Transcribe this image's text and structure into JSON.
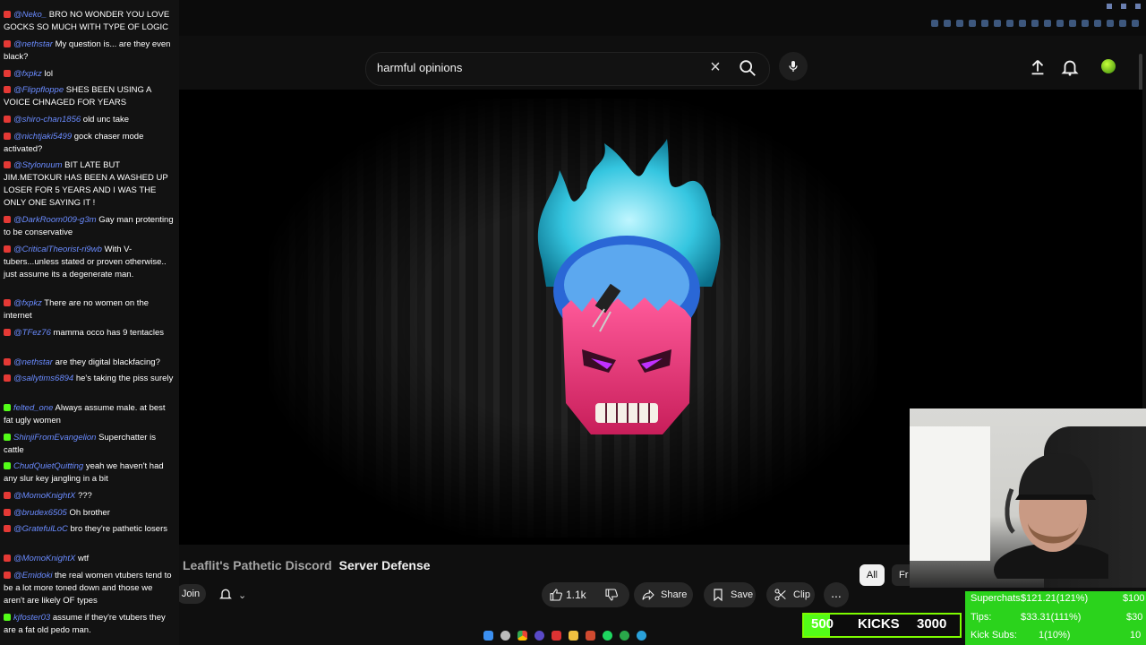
{
  "search": {
    "query": "harmful opinions"
  },
  "video": {
    "title_overlay": "Leaflit's Pathetic Discord",
    "title": "Server Defense",
    "join_label": "Join",
    "like_count": "1.1k",
    "share_label": "Share",
    "save_label": "Save",
    "clip_label": "Clip",
    "more_label": "...",
    "chips": [
      "All",
      "Fr"
    ]
  },
  "chat": [
    {
      "src": "yt",
      "user": "@Neko_",
      "text": "BRO NO WONDER YOU LOVE GOCKS SO MUCH WITH TYPE OF LOGIC"
    },
    {
      "src": "yt",
      "user": "@nethstar",
      "text": "My question is... are they even black?"
    },
    {
      "src": "yt",
      "user": "@fxpkz",
      "text": "lol"
    },
    {
      "src": "yt",
      "user": "@Flippfloppe",
      "text": "SHES BEEN USING A VOICE CHNAGED FOR YEARS"
    },
    {
      "src": "yt",
      "user": "@shiro-chan1856",
      "text": "old unc take"
    },
    {
      "src": "yt",
      "user": "@nichtjaki5499",
      "text": "gock chaser mode activated?"
    },
    {
      "src": "yt",
      "user": "@Stylonuum",
      "text": "BIT LATE BUT JIM.METOKUR HAS BEEN A WASHED UP LOSER FOR 5 YEARS AND I WAS THE ONLY ONE SAYING IT !"
    },
    {
      "src": "yt",
      "user": "@DarkRoom009-g3m",
      "text": "Gay man protenting to be conservative"
    },
    {
      "src": "yt",
      "user": "@CriticalTheorist-ri9wb",
      "text": "With V-tubers...unless stated or proven otherwise.. just assume its a degenerate man."
    },
    {
      "src": "yt",
      "user": "@fxpkz",
      "text": "There are no women on the internet"
    },
    {
      "src": "yt",
      "user": "@TFez76",
      "text": "mamma occo has 9 tentacles"
    },
    {
      "src": "yt",
      "user": "@nethstar",
      "text": "are they digital blackfacing?"
    },
    {
      "src": "yt",
      "user": "@sallytims6894",
      "text": "he's taking the piss surely"
    },
    {
      "src": "kick",
      "user": "felted_one",
      "text": "Always assume male. at best fat ugly women"
    },
    {
      "src": "kick",
      "user": "ShinjiFromEvangelion",
      "text": "Superchatter is cattle"
    },
    {
      "src": "kick",
      "user": "ChudQuietQuitting",
      "text": "yeah we haven't had any slur key jangling in a bit"
    },
    {
      "src": "yt",
      "user": "@MomoKnightX",
      "text": "???"
    },
    {
      "src": "yt",
      "user": "@brudex6505",
      "text": "Oh brother"
    },
    {
      "src": "yt",
      "user": "@GratefulLoC",
      "text": "bro they're pathetic losers"
    },
    {
      "src": "yt",
      "user": "@MomoKnightX",
      "text": "wtf"
    },
    {
      "src": "yt",
      "user": "@Emidoki",
      "text": "the real women vtubers tend to be a lot more toned down and those we aren't are likely OF types"
    },
    {
      "src": "kick",
      "user": "kjfoster03",
      "text": "assume if they're vtubers they are a fat old pedo man."
    }
  ],
  "kick_goal": {
    "current": "500",
    "label": "KICKS",
    "target": "3000",
    "progress": 0.167
  },
  "stats": {
    "superchats_label": "Superchats:",
    "superchats_value": "$121.21(121%)",
    "superchats_goal": "$100",
    "tips_label": "Tips:",
    "tips_value": "$33.31(111%)",
    "tips_goal": "$30",
    "kicksubs_label": "Kick Subs:",
    "kicksubs_value": "1(10%)",
    "kicksubs_goal": "10"
  },
  "colors": {
    "accent_green": "#53fc18",
    "chat_user": "#6a8bff",
    "bg": "#0f0f0f"
  }
}
